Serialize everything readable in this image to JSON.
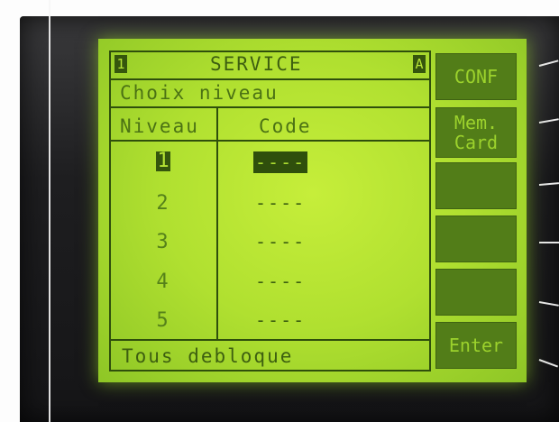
{
  "header": {
    "title": "SERVICE",
    "left_indicator": "1",
    "right_indicator": "A"
  },
  "subtitle": "Choix niveau",
  "table": {
    "columns": [
      "Niveau",
      "Code"
    ],
    "rows": [
      {
        "level": "1",
        "code": "----",
        "selected": true
      },
      {
        "level": "2",
        "code": "----",
        "selected": false
      },
      {
        "level": "3",
        "code": "----",
        "selected": false
      },
      {
        "level": "4",
        "code": "----",
        "selected": false
      },
      {
        "level": "5",
        "code": "----",
        "selected": false
      }
    ]
  },
  "footer": "Tous debloque",
  "softkeys": [
    "CONF",
    "Mem.",
    "Card",
    "",
    "",
    "",
    "Enter"
  ],
  "colors": {
    "lcd_background": "#b6e435",
    "lcd_text": "#3d5f10",
    "softkey_background": "#527d18"
  }
}
